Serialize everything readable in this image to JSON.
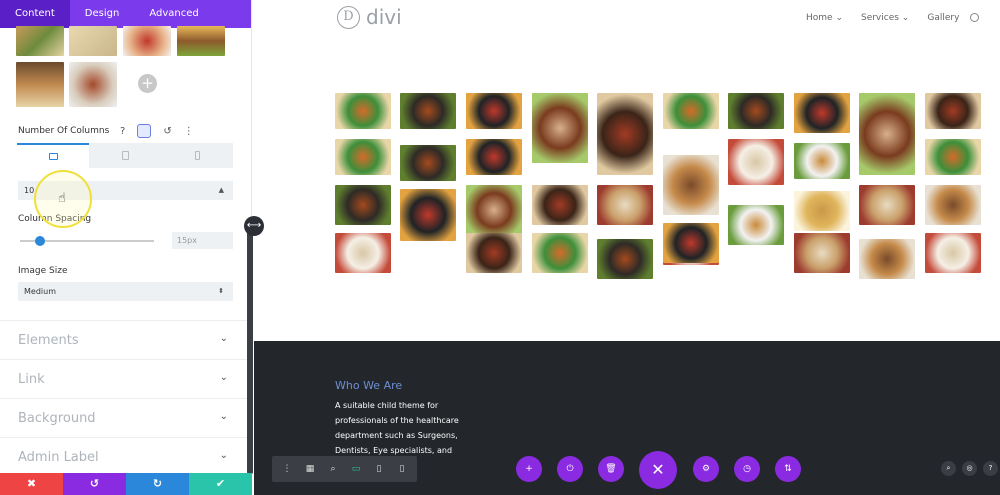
{
  "panel": {
    "tabs": [
      {
        "label": "Content"
      },
      {
        "label": "Design"
      },
      {
        "label": "Advanced"
      }
    ],
    "columns": {
      "label": "Number Of Columns",
      "help_icon": "?",
      "value": "10"
    },
    "spacing": {
      "label": "Column Spacing",
      "value": "15px",
      "slider_fraction": 0.15
    },
    "image_size": {
      "label": "Image Size",
      "value": "Medium"
    },
    "sections": [
      {
        "label": "Elements"
      },
      {
        "label": "Link"
      },
      {
        "label": "Background"
      },
      {
        "label": "Admin Label"
      }
    ],
    "footer": [
      {
        "icon": "close-icon",
        "glyph": "✖",
        "color": "#ef4444"
      },
      {
        "icon": "undo-icon",
        "glyph": "↺",
        "color": "#8a2be2"
      },
      {
        "icon": "redo-icon",
        "glyph": "↻",
        "color": "#2b87da"
      },
      {
        "icon": "check-icon",
        "glyph": "✔",
        "color": "#29c4a9"
      }
    ]
  },
  "header": {
    "logo_letter": "D",
    "logo_text": "divi",
    "nav": [
      {
        "label": "Home ⌄"
      },
      {
        "label": "Services ⌄"
      },
      {
        "label": "Gallery"
      }
    ]
  },
  "dark_section": {
    "title": "Who We Are",
    "body": "A suitable child theme for professionals of the healthcare department such as Surgeons, Dentists, Eye specialists, and"
  },
  "colors": {
    "accent": "#8a2be2",
    "tab_bar": "#7c3aed",
    "blue": "#2b87da",
    "teal": "#29c4a9",
    "dark_bg": "#23262b"
  }
}
